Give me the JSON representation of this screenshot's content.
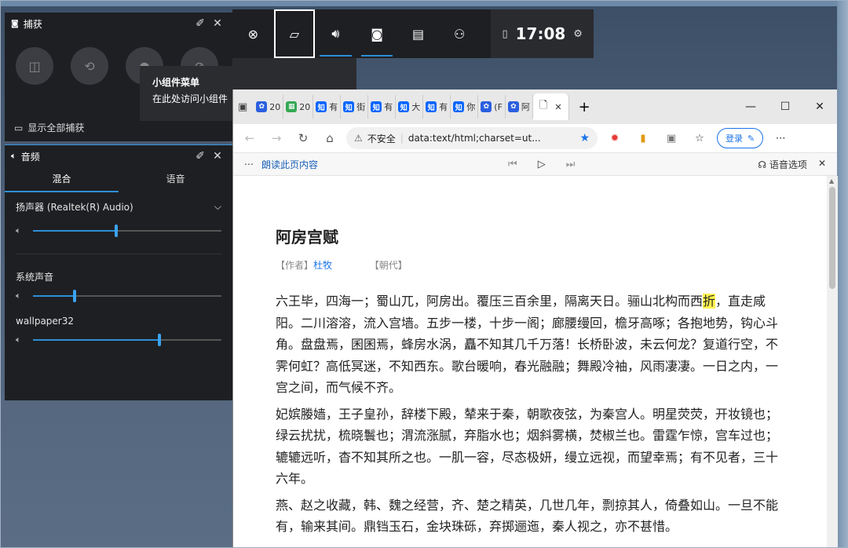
{
  "capture_widget": {
    "title": "捕获",
    "show_all_label": "显示全部捕获"
  },
  "tooltip": {
    "title": "小组件菜单",
    "desc": "在此处访问小组件"
  },
  "audio_widget": {
    "title": "音频",
    "tabs": [
      "混合",
      "语音"
    ],
    "device": "扬声器 (Realtek(R) Audio)",
    "device_volume": 0.44,
    "system_label": "系统声音",
    "system_volume": 0.22,
    "app_label": "wallpaper32",
    "app_volume": 0.67
  },
  "gamebar": {
    "time": "17:08"
  },
  "browser": {
    "tabs": [
      {
        "icon": "paw",
        "color": "#2b5fe0",
        "text": "20"
      },
      {
        "icon": "grid",
        "color": "#34a853",
        "text": "20"
      },
      {
        "icon": "zhi",
        "color": "#0a66ff",
        "text": "有"
      },
      {
        "icon": "zhi",
        "color": "#0a66ff",
        "text": "街"
      },
      {
        "icon": "zhi",
        "color": "#0a66ff",
        "text": "有"
      },
      {
        "icon": "zhi",
        "color": "#0a66ff",
        "text": "大"
      },
      {
        "icon": "zhi",
        "color": "#0a66ff",
        "text": "有"
      },
      {
        "icon": "zhi",
        "color": "#0a66ff",
        "text": "你"
      },
      {
        "icon": "paw",
        "color": "#2b5fe0",
        "text": "(F"
      },
      {
        "icon": "paw",
        "color": "#2b5fe0",
        "text": "阿"
      }
    ],
    "insecure_label": "不安全",
    "url": "data:text/html;charset=ut...",
    "login_label": "登录",
    "read_aloud_label": "朗读此页内容",
    "voice_options_label": "语音选项"
  },
  "document": {
    "title": "阿房宫赋",
    "author_tag": "【作者】",
    "author": "杜牧",
    "dynasty_tag": "【朝代】",
    "paragraphs": [
      "六王毕，四海一；蜀山兀，阿房出。覆压三百余里，隔离天日。骊山北构而西折，直走咸阳。二川溶溶，流入宫墙。五步一楼，十步一阁；廊腰缦回，檐牙高啄；各抱地势，钩心斗角。盘盘焉，囷囷焉，蜂房水涡，矗不知其几千万落！长桥卧波，未云何龙？复道行空，不霁何虹？高低冥迷，不知西东。歌台暖响，春光融融；舞殿冷袖，风雨凄凄。一日之内，一宫之间，而气候不齐。",
      "妃嫔媵嫱，王子皇孙，辞楼下殿，辇来于秦，朝歌夜弦，为秦宫人。明星荧荧，开妆镜也；绿云扰扰，梳晓鬟也；渭流涨腻，弃脂水也；烟斜雾横，焚椒兰也。雷霆乍惊，宫车过也；辘辘远听，杳不知其所之也。一肌一容，尽态极妍，缦立远视，而望幸焉；有不见者，三十六年。",
      "燕、赵之收藏，韩、魏之经营，齐、楚之精英，几世几年，剽掠其人，倚叠如山。一旦不能有，输来其间。鼎铛玉石，金块珠砾，弃掷逦迤，秦人视之，亦不甚惜。"
    ]
  }
}
